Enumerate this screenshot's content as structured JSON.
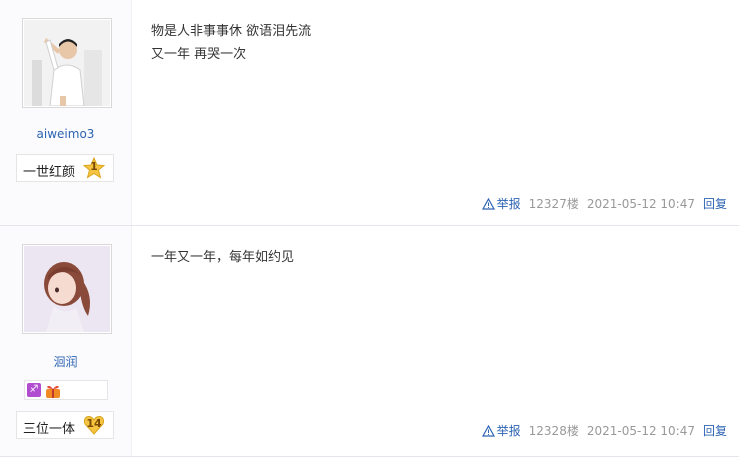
{
  "posts": [
    {
      "username": "aiweimo3",
      "level_name": "一世红颜",
      "level_number": "1",
      "content_lines": [
        "物是人非事事休 欲语泪先流",
        "又一年 再哭一次"
      ],
      "report_label": "举报",
      "floor": "12327楼",
      "time": "2021-05-12 10:47",
      "reply_label": "回复",
      "avatar_icon": "avatar-boy-saluting"
    },
    {
      "username": "洄润",
      "level_name": "三位一体",
      "level_number": "14",
      "content_lines": [
        "一年又一年，每年如约见"
      ],
      "zodiac_symbol": "♐",
      "report_label": "举报",
      "floor": "12328楼",
      "time": "2021-05-12 10:47",
      "reply_label": "回复",
      "avatar_icon": "avatar-girl-anime"
    }
  ],
  "colors": {
    "link": "#2d64b3",
    "meta": "#999999",
    "zodiac_bg": "#b14bd0",
    "level_gold": "#f5c542"
  }
}
